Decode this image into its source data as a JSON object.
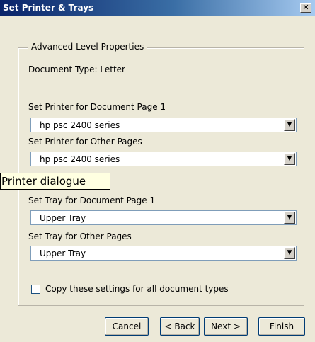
{
  "window": {
    "title": "Set Printer & Trays",
    "close_symbol": "✕"
  },
  "group": {
    "legend": "Advanced Level Properties"
  },
  "document_type": "Document Type: Letter",
  "printer_page1": {
    "label": "Set Printer for Document Page 1",
    "value": "hp psc 2400 series"
  },
  "printer_other": {
    "label": "Set Printer for Other Pages",
    "value": "hp psc 2400 series"
  },
  "tray_page1": {
    "label": "Set Tray for Document Page 1",
    "value": "Upper Tray"
  },
  "tray_other": {
    "label": "Set Tray for Other Pages",
    "value": "Upper Tray"
  },
  "copy_settings": {
    "label": "Copy these settings for all document types",
    "checked": false
  },
  "buttons": {
    "cancel": "Cancel",
    "back": "< Back",
    "next": "Next >",
    "finish": "Finish"
  },
  "tooltip": {
    "text": "Printer dialogue"
  },
  "icons": {
    "dropdown_arrow": "▼"
  }
}
